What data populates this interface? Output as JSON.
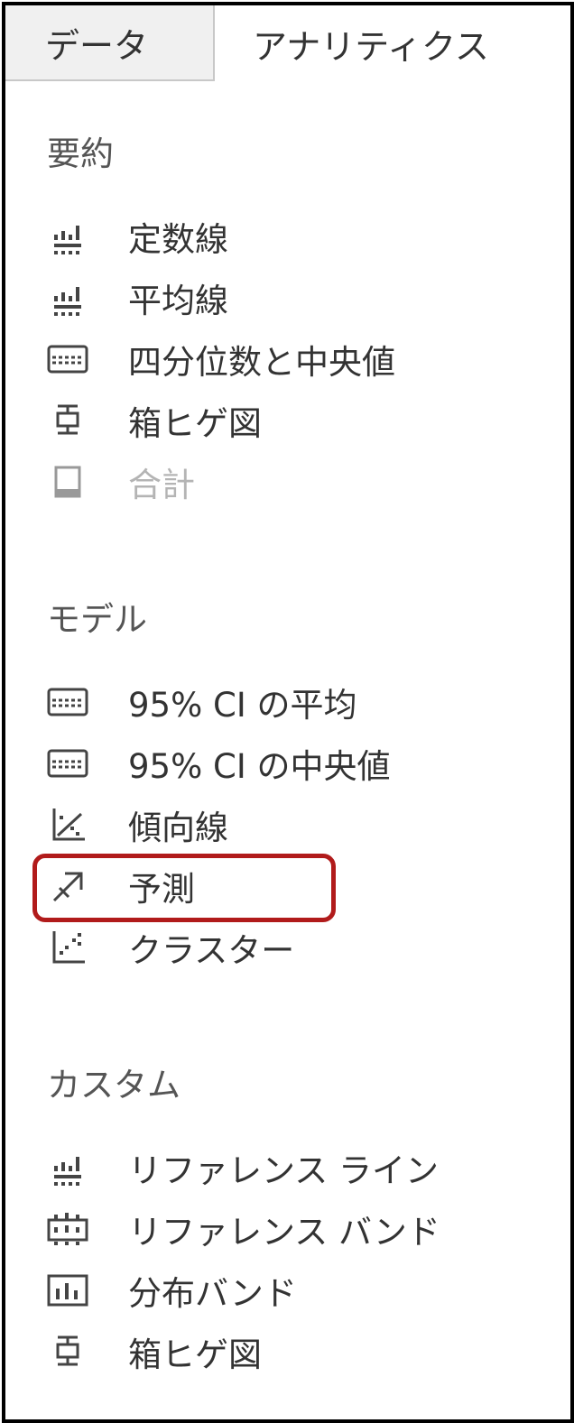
{
  "tabs": [
    {
      "label": "データ",
      "active": false
    },
    {
      "label": "アナリティクス",
      "active": true
    }
  ],
  "sections": {
    "summary": {
      "title": "要約",
      "items": [
        {
          "label": "定数線",
          "icon": "reference-line-icon",
          "enabled": true
        },
        {
          "label": "平均線",
          "icon": "reference-line-icon",
          "enabled": true
        },
        {
          "label": "四分位数と中央値",
          "icon": "band-icon",
          "enabled": true
        },
        {
          "label": "箱ヒゲ図",
          "icon": "box-plot-icon",
          "enabled": true
        },
        {
          "label": "合計",
          "icon": "totals-icon",
          "enabled": false
        }
      ]
    },
    "model": {
      "title": "モデル",
      "items": [
        {
          "label": "95% CI の平均",
          "icon": "band-icon",
          "enabled": true
        },
        {
          "label": "95% CI の中央値",
          "icon": "band-icon",
          "enabled": true
        },
        {
          "label": "傾向線",
          "icon": "trend-line-icon",
          "enabled": true
        },
        {
          "label": "予測",
          "icon": "forecast-icon",
          "enabled": true,
          "highlighted": true
        },
        {
          "label": "クラスター",
          "icon": "cluster-icon",
          "enabled": true
        }
      ]
    },
    "custom": {
      "title": "カスタム",
      "items": [
        {
          "label": "リファレンス ライン",
          "icon": "reference-line-icon",
          "enabled": true
        },
        {
          "label": "リファレンス バンド",
          "icon": "reference-band-icon",
          "enabled": true
        },
        {
          "label": "分布バンド",
          "icon": "distribution-band-icon",
          "enabled": true
        },
        {
          "label": "箱ヒゲ図",
          "icon": "box-plot-icon",
          "enabled": true
        }
      ]
    }
  },
  "colors": {
    "highlight_border": "#b11b1b",
    "text": "#333333",
    "disabled_text": "#b4b4b4",
    "inactive_tab_bg": "#f0f0f0"
  }
}
